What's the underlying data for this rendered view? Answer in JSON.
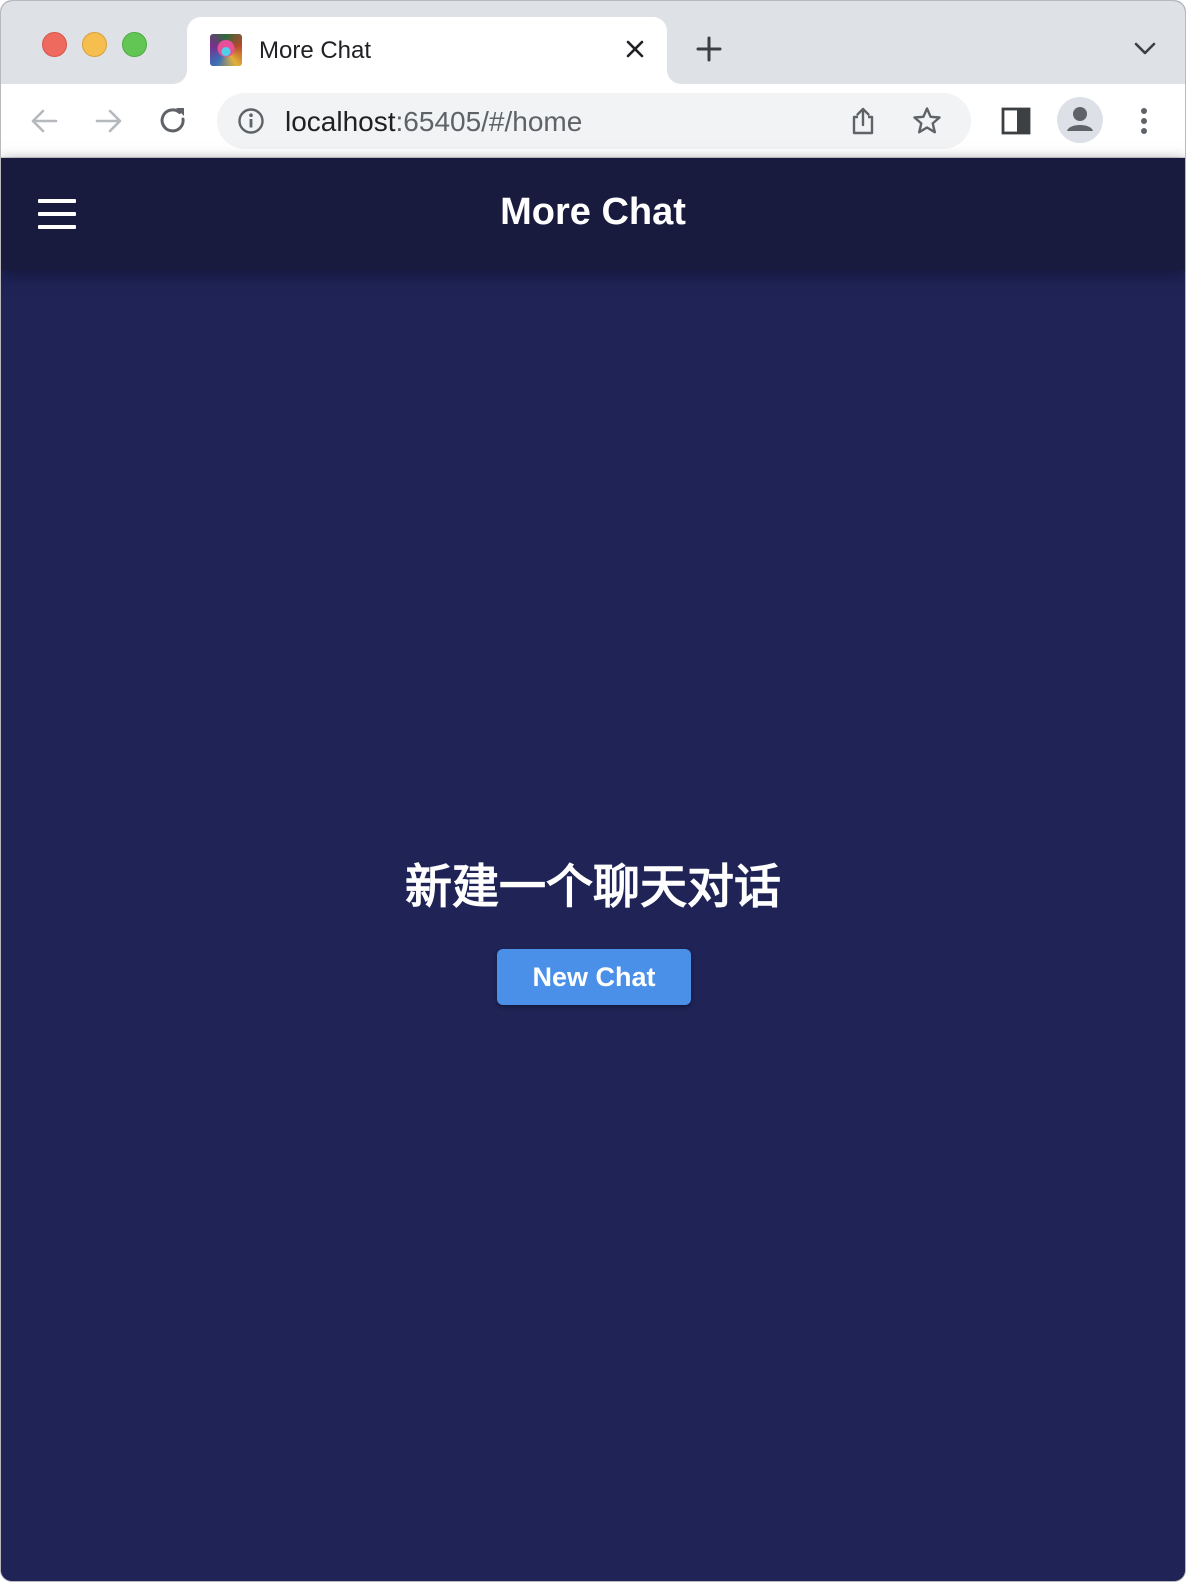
{
  "browser": {
    "tab": {
      "title": "More Chat",
      "favicon": "app-favicon"
    },
    "address": {
      "host": "localhost",
      "rest": ":65405/#/home"
    },
    "icons": {
      "back": "arrow-left-icon",
      "forward": "arrow-right-icon",
      "reload": "reload-icon",
      "info": "info-icon",
      "share": "share-icon",
      "bookmark": "star-icon",
      "sidepanel": "side-panel-icon",
      "profile": "profile-icon",
      "menu": "kebab-menu-icon",
      "new_tab": "plus-icon",
      "tab_search": "chevron-down-icon",
      "close_tab": "close-icon"
    }
  },
  "app": {
    "title": "More Chat",
    "menu_icon": "hamburger-menu-icon",
    "empty_state": {
      "title": "新建一个聊天对话",
      "button_label": "New Chat"
    },
    "colors": {
      "background": "#1f2356",
      "appbar": "#181b3d",
      "button": "#4a90e8",
      "text": "#ffffff"
    }
  }
}
